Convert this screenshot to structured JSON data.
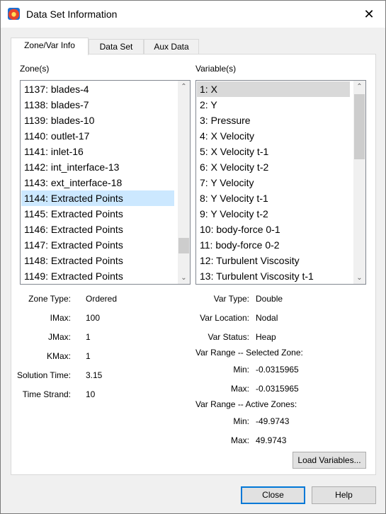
{
  "window": {
    "title": "Data Set Information"
  },
  "tabs": [
    {
      "label": "Zone/Var Info",
      "active": true
    },
    {
      "label": "Data Set",
      "active": false
    },
    {
      "label": "Aux Data",
      "active": false
    }
  ],
  "zones": {
    "label": "Zone(s)",
    "items": [
      "1137: blades-4",
      "1138: blades-7",
      "1139: blades-10",
      "1140: outlet-17",
      "1141: inlet-16",
      "1142: int_interface-13",
      "1143: ext_interface-18",
      "1144: Extracted Points",
      "1145: Extracted Points",
      "1146: Extracted Points",
      "1147: Extracted Points",
      "1148: Extracted Points",
      "1149: Extracted Points"
    ],
    "selected": "1144: Extracted Points"
  },
  "variables": {
    "label": "Variable(s)",
    "items": [
      "1: X",
      "2: Y",
      "3: Pressure",
      "4: X Velocity",
      "5: X Velocity t-1",
      "6: X Velocity t-2",
      "7: Y Velocity",
      "8: Y Velocity t-1",
      "9: Y Velocity t-2",
      "10: body-force 0-1",
      "11: body-force 0-2",
      "12: Turbulent Viscosity",
      "13: Turbulent Viscosity t-1"
    ],
    "selected": "1: X"
  },
  "zone_info": {
    "zone_type_label": "Zone Type:",
    "zone_type": "Ordered",
    "imax_label": "IMax:",
    "imax": "100",
    "jmax_label": "JMax:",
    "jmax": "1",
    "kmax_label": "KMax:",
    "kmax": "1",
    "solution_time_label": "Solution Time:",
    "solution_time": "3.15",
    "time_strand_label": "Time Strand:",
    "time_strand": "10"
  },
  "var_info": {
    "var_type_label": "Var Type:",
    "var_type": "Double",
    "var_location_label": "Var Location:",
    "var_location": "Nodal",
    "var_status_label": "Var Status:",
    "var_status": "Heap",
    "range_selected_label": "Var Range -- Selected Zone:",
    "sel_min_label": "Min:",
    "sel_min": "-0.0315965",
    "sel_max_label": "Max:",
    "sel_max": "-0.0315965",
    "range_active_label": "Var Range -- Active Zones:",
    "act_min_label": "Min:",
    "act_min": "-49.9743",
    "act_max_label": "Max:",
    "act_max": "49.9743"
  },
  "buttons": {
    "load_variables": "Load Variables...",
    "close": "Close",
    "help": "Help"
  },
  "icons": {
    "app": "tecplot-app-icon",
    "close": "close-icon",
    "scroll_up": "chevron-up-icon",
    "scroll_down": "chevron-down-icon"
  }
}
